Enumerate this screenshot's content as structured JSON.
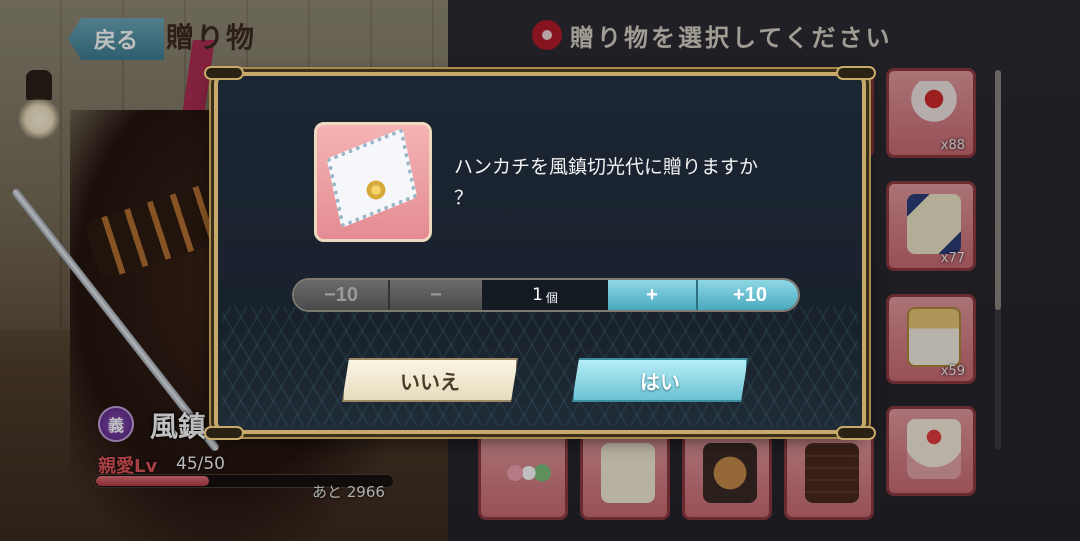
{
  "header": {
    "back_label": "戻る",
    "title": "贈り物"
  },
  "gift_panel": {
    "title": "贈り物を選択してください",
    "items": [
      {
        "count": "x88",
        "icon": "ribbon-doll-icon"
      },
      {
        "count": "x77",
        "icon": "scroll-painting-icon"
      },
      {
        "count": "x59",
        "icon": "jewelry-box-icon"
      },
      {
        "count": "",
        "icon": "cake-icon"
      },
      {
        "count": "",
        "icon": "dango-icon"
      },
      {
        "count": "",
        "icon": "sweets-plate-icon"
      },
      {
        "count": "",
        "icon": "cookie-box-icon"
      },
      {
        "count": "",
        "icon": "chocolate-icon"
      }
    ]
  },
  "character": {
    "faction_badge": "義",
    "name": "風鎮",
    "affection_label": "親愛Lv",
    "affection_level": "45/50",
    "exp_remaining": "あと 2966",
    "exp_progress": 0.38
  },
  "dialog": {
    "item_icon": "handkerchief-icon",
    "message_line1": "ハンカチを風鎮切光代に贈りますか",
    "message_line2": "？",
    "quantity": {
      "minus10_label": "−10",
      "minus_label": "−",
      "value": "1",
      "unit": "個",
      "plus_label": "+",
      "plus10_label": "+10"
    },
    "no_label": "いいえ",
    "yes_label": "はい"
  },
  "colors": {
    "accent_teal": "#6cc2d4",
    "frame_gold": "#c7a969",
    "affection_red": "#e0555a"
  }
}
